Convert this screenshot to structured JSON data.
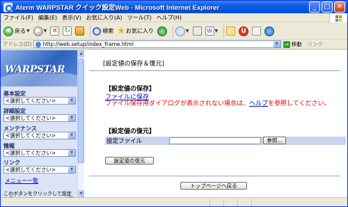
{
  "window": {
    "title": "Aterm WARPSTAR クイック設定Web - Microsoft Internet Explorer",
    "min_glyph": "_",
    "max_glyph": "□",
    "close_glyph": "✕"
  },
  "menubar": {
    "items": [
      "ファイル(F)",
      "編集(E)",
      "表示(V)",
      "お気に入り(A)",
      "ツール(T)",
      "ヘルプ(H)"
    ]
  },
  "toolbar": {
    "back_label": "戻る",
    "search_label": "検索",
    "favorites_label": "お気に入り"
  },
  "address": {
    "label": "アドレス(D)",
    "url": "http://web.setup/index_frame.html",
    "go_label": "移動",
    "links_label": "リンク"
  },
  "sidebar": {
    "logo_text": "WARPSTAR",
    "sections": [
      {
        "title": "基本設定",
        "select_value": "<選択してください>"
      },
      {
        "title": "詳細設定",
        "select_value": "<選択してください>"
      },
      {
        "title": "メンテナンス",
        "select_value": "<選択してください>"
      },
      {
        "title": "情報",
        "select_value": "<選択してください>"
      },
      {
        "title": "リンク",
        "select_value": "<選択してください>"
      }
    ],
    "menu_list_link": "メニュー一覧",
    "note": "このボタンをクリックして設定を保存します。WARPSTARが再"
  },
  "main": {
    "page_title": "[設定値の保存＆復元]",
    "save_heading": "【設定値の保存】",
    "save_link": "ファイルに保存",
    "warning_prefix": "ファイル保存用ダイアログが表示されない場合は、",
    "warning_link": "ヘルプ",
    "warning_suffix": "を参照してください。",
    "restore_heading": "【設定値の復元】",
    "file_label": "設定ファイル",
    "file_value": "",
    "browse_button": "参照...",
    "restore_button": "設定値の復元",
    "top_button": "トップページへ戻る"
  }
}
